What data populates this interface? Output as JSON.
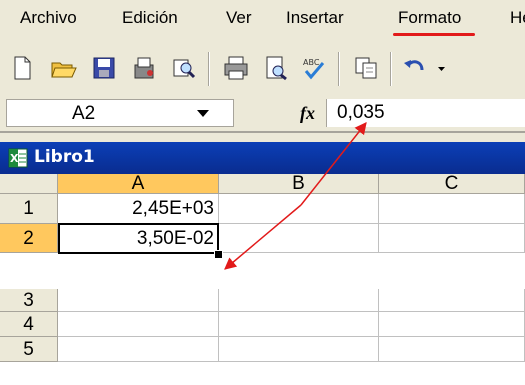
{
  "menu": [
    "Archivo",
    "Edición",
    "Ver",
    "Insertar",
    "Formato",
    "He"
  ],
  "toolbar_icons": [
    "new-icon",
    "open-icon",
    "save-icon",
    "permission-icon",
    "search-icon",
    "print-icon",
    "print-preview-icon",
    "spelling-icon",
    "copy-icon",
    "undo-icon"
  ],
  "namebox": {
    "value": "A2"
  },
  "formula": {
    "fx": "fx",
    "value": "0,035"
  },
  "workbook": {
    "title": "Libro1"
  },
  "columns": [
    "A",
    "B",
    "C"
  ],
  "rows": [
    {
      "num": "1",
      "cells": [
        "2,45E+03",
        "",
        ""
      ]
    },
    {
      "num": "2",
      "cells": [
        "3,50E-02",
        "",
        ""
      ]
    },
    {
      "num": "3",
      "cells": [
        "",
        "",
        ""
      ]
    },
    {
      "num": "4",
      "cells": [
        "",
        "",
        ""
      ]
    },
    {
      "num": "5",
      "cells": [
        "",
        "",
        ""
      ]
    }
  ],
  "colors": {
    "annotation": "#e21a1a",
    "titlebar": "#0a2c8f",
    "selected_header": "#ffc85e"
  }
}
